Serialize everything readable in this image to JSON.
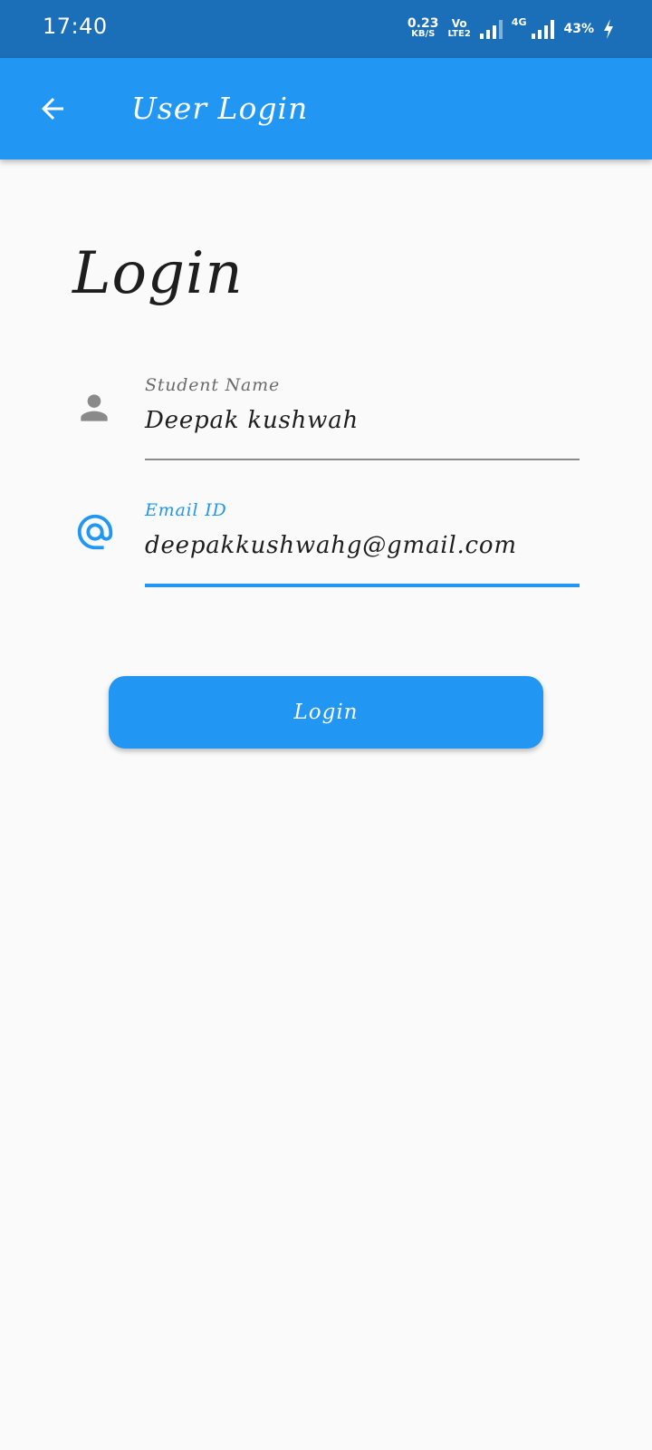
{
  "status_bar": {
    "time": "17:40",
    "net_speed_value": "0.23",
    "net_speed_unit": "KB/S",
    "volte_top": "Vo",
    "volte_bottom": "LTE2",
    "network_type": "4G",
    "battery": "43%"
  },
  "app_bar": {
    "title": "User Login",
    "back_icon": "arrow-back-icon"
  },
  "page": {
    "heading": "Login"
  },
  "form": {
    "student_name": {
      "label": "Student Name",
      "value": "Deepak kushwah",
      "icon": "person-icon"
    },
    "email": {
      "label": "Email ID",
      "value": "deepakkushwahg@gmail.com",
      "icon": "at-sign-icon"
    },
    "login_button": "Login"
  },
  "colors": {
    "status_bar": "#1b6fb8",
    "primary": "#2196f3",
    "background": "#fafafa",
    "text": "#1e1e1e",
    "muted": "#6b6b6b",
    "icon_gray": "#8a8a8a"
  }
}
